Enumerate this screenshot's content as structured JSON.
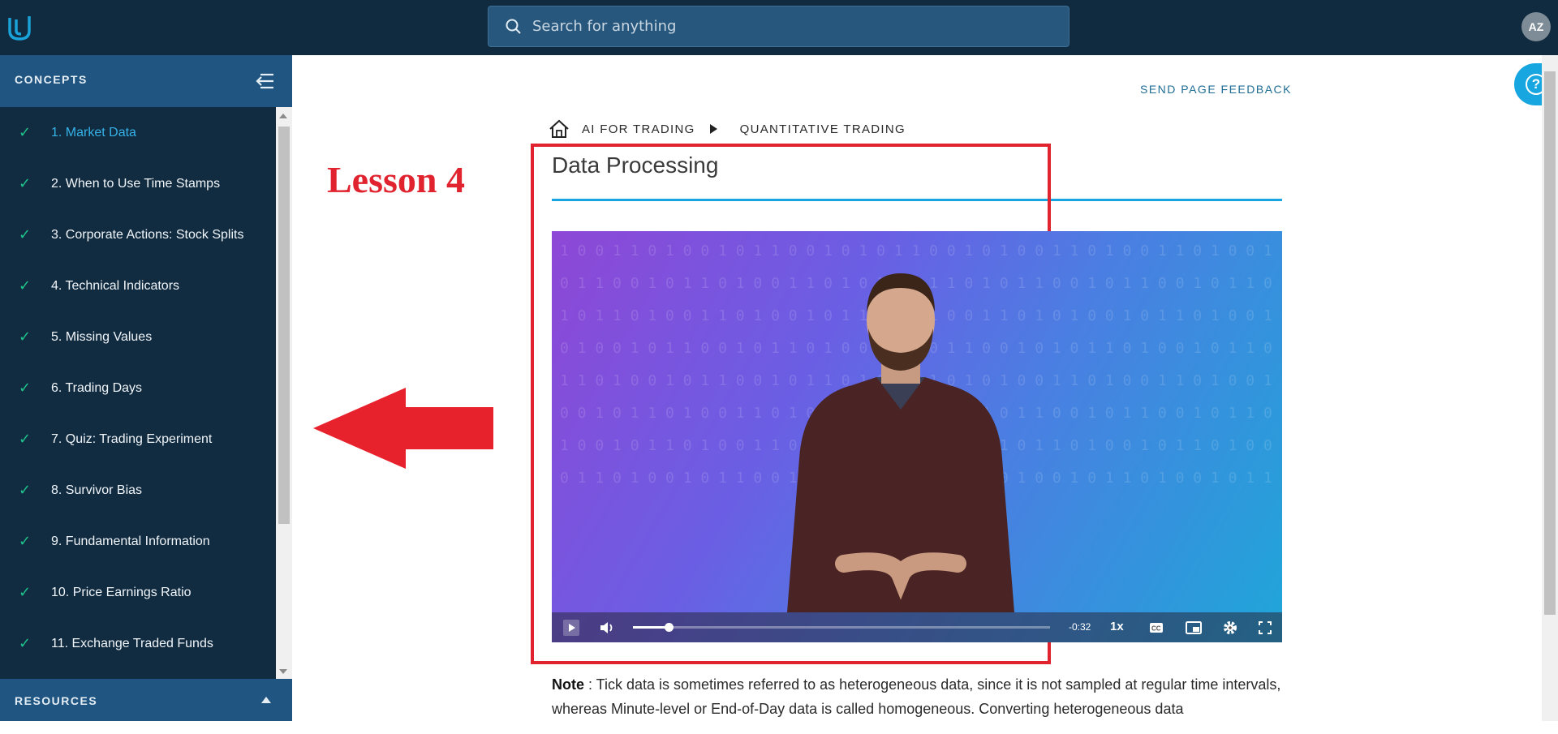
{
  "header": {
    "search_placeholder": "Search for anything",
    "avatar_initials": "AZ"
  },
  "sidebar": {
    "title": "CONCEPTS",
    "items": [
      {
        "label": "1. Market Data",
        "active": true
      },
      {
        "label": "2. When to Use Time Stamps"
      },
      {
        "label": "3. Corporate Actions: Stock Splits"
      },
      {
        "label": "4. Technical Indicators"
      },
      {
        "label": "5. Missing Values"
      },
      {
        "label": "6. Trading Days"
      },
      {
        "label": "7. Quiz: Trading Experiment"
      },
      {
        "label": "8. Survivor Bias"
      },
      {
        "label": "9. Fundamental Information"
      },
      {
        "label": "10. Price Earnings Ratio"
      },
      {
        "label": "11. Exchange Traded Funds"
      }
    ],
    "check_glyph": "✓",
    "resources_title": "RESOURCES"
  },
  "main": {
    "feedback_link": "SEND PAGE FEEDBACK",
    "help_glyph": "?",
    "breadcrumb": [
      "AI FOR TRADING",
      "QUANTITATIVE TRADING"
    ],
    "page_title": "Data Processing",
    "annotation": "Lesson 4",
    "video": {
      "time_remaining": "-0:32",
      "speed": "1x",
      "progress": 0.085
    },
    "note": {
      "label": "Note",
      "text": " : Tick data is sometimes referred to as heterogeneous data, since it is not sampled at regular time intervals, whereas Minute-level or End-of-Day data is called homogeneous. Converting heterogeneous data"
    }
  },
  "colors": {
    "topbar": "#102b3f",
    "sidebar": "#112b40",
    "sidebar_header": "#1f5580",
    "accent": "#18a6e0",
    "check": "#1fc28b",
    "annotation_red": "#e0232e"
  }
}
